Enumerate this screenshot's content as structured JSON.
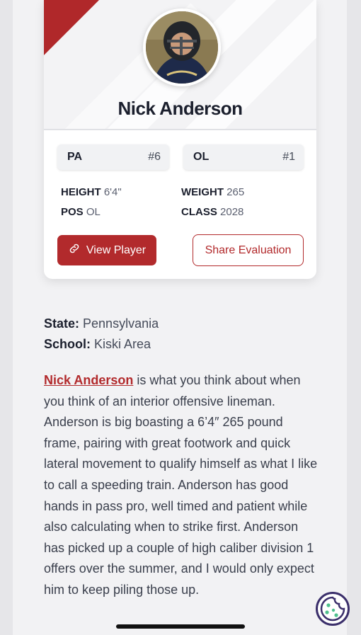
{
  "player": {
    "name": "Nick Anderson",
    "state_chip": {
      "label": "PA",
      "rank": "#6"
    },
    "position_chip": {
      "label": "OL",
      "rank": "#1"
    },
    "stats": {
      "height_label": "HEIGHT",
      "height_value": "6'4\"",
      "weight_label": "WEIGHT",
      "weight_value": "265",
      "pos_label": "POS",
      "pos_value": "OL",
      "class_label": "CLASS",
      "class_value": "2028"
    }
  },
  "buttons": {
    "view_player": "View Player",
    "share_evaluation": "Share Evaluation"
  },
  "info": {
    "state_label": "State:",
    "state_value": "Pennsylvania",
    "school_label": "School:",
    "school_value": "Kiski Area"
  },
  "evaluation": {
    "link_text": "Nick Anderson",
    "text": " is what you think about when you think of an interior offensive lineman. Anderson is big boasting a 6’4″ 265 pound frame, pairing with great footwork and quick lateral movement to qualify himself as what I like to call a speeding train. Anderson has good hands in pass pro, well timed and patient while also calculating when to strike first. Anderson has picked up a couple of high caliber division 1 offers over the summer, and I would only expect him to keep piling those up."
  },
  "colors": {
    "accent": "#b22a2c",
    "text": "#1b1f2d",
    "cookie": "#3b2f6b"
  }
}
